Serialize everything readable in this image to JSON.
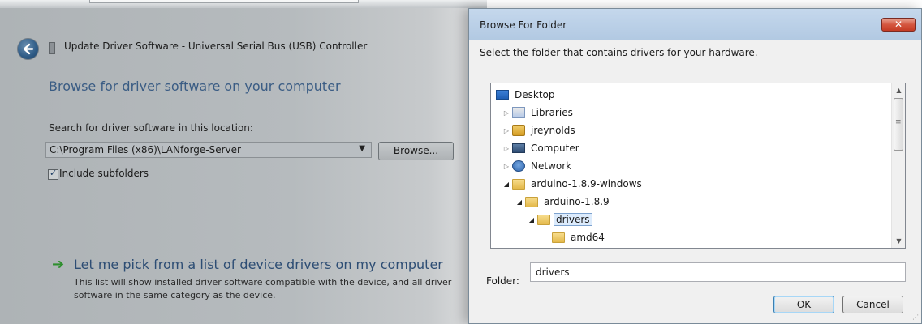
{
  "wizard": {
    "title": "Update Driver Software - Universal Serial Bus (USB) Controller",
    "heading": "Browse for driver software on your computer",
    "search_label": "Search for driver software in this location:",
    "path_value": "C:\\Program Files (x86)\\LANforge-Server",
    "browse_label": "Browse...",
    "include_subfolders_label": "Include subfolders",
    "include_subfolders_checked": true,
    "pick_title": "Let me pick from a list of device drivers on my computer",
    "pick_description": "This list will show installed driver software compatible with the device, and all driver software in the same category as the device."
  },
  "dialog": {
    "title": "Browse For Folder",
    "close_label": "✕",
    "description": "Select the folder that contains drivers for your hardware.",
    "tree": [
      {
        "label": "Desktop",
        "icon": "desktop-icon",
        "level": 0,
        "expander": "none"
      },
      {
        "label": "Libraries",
        "icon": "libraries-icon",
        "level": 1,
        "expander": "collapsed"
      },
      {
        "label": "jreynolds",
        "icon": "user-folder-icon",
        "level": 1,
        "expander": "collapsed"
      },
      {
        "label": "Computer",
        "icon": "computer-icon",
        "level": 1,
        "expander": "collapsed"
      },
      {
        "label": "Network",
        "icon": "network-icon",
        "level": 1,
        "expander": "collapsed"
      },
      {
        "label": "arduino-1.8.9-windows",
        "icon": "folder-icon",
        "level": 1,
        "expander": "expanded"
      },
      {
        "label": "arduino-1.8.9",
        "icon": "folder-icon",
        "level": 2,
        "expander": "expanded"
      },
      {
        "label": "drivers",
        "icon": "folder-icon",
        "level": 3,
        "expander": "expanded",
        "selected": true
      },
      {
        "label": "amd64",
        "icon": "folder-icon",
        "level": 4,
        "expander": "none"
      }
    ],
    "folder_label": "Folder:",
    "folder_value": "drivers",
    "ok_label": "OK",
    "cancel_label": "Cancel"
  }
}
